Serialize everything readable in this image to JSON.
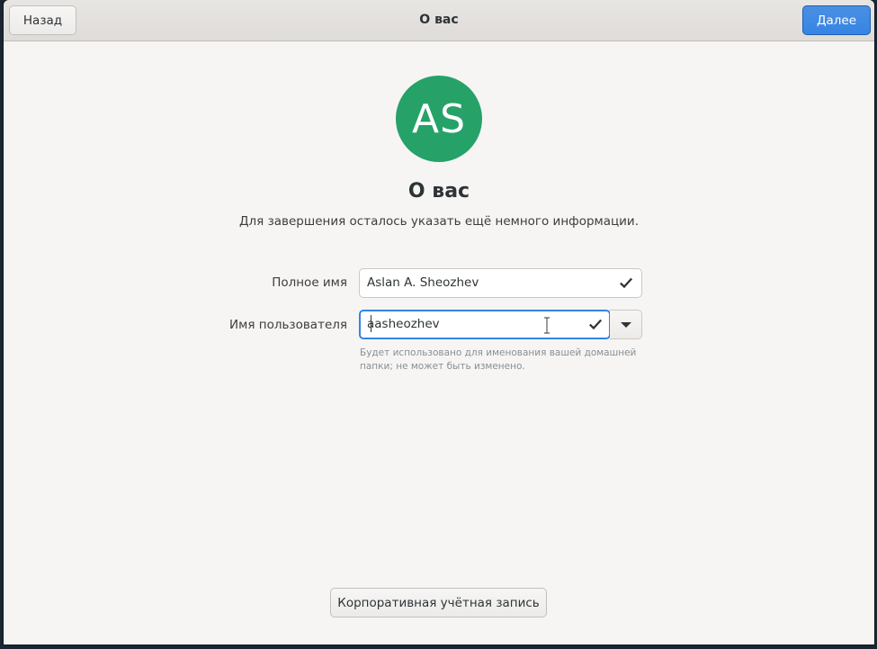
{
  "header": {
    "back_label": "Назад",
    "title": "О вас",
    "next_label": "Далее"
  },
  "avatar": {
    "initials": "AS",
    "color": "#26a269"
  },
  "main": {
    "title": "О вас",
    "subtitle": "Для завершения осталось указать ещё немного информации."
  },
  "form": {
    "fullname": {
      "label": "Полное имя",
      "value": "Aslan A. Sheozhev"
    },
    "username": {
      "label": "Имя пользователя",
      "value": "aasheozhev",
      "hint": "Будет использовано для именования вашей домашней папки; не может быть изменено."
    }
  },
  "footer": {
    "enterprise_label": "Корпоративная учётная запись"
  },
  "colors": {
    "accent": "#3584e4",
    "window_bg": "#f6f5f4"
  }
}
